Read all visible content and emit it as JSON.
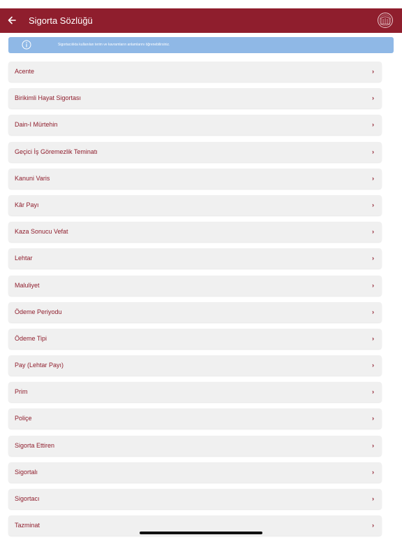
{
  "header": {
    "title": "Sigorta Sözlüğü"
  },
  "info_banner": {
    "text": "Sigortacılıkta kullanılan terim ve kavramların anlamlarını öğrenebilirsiniz."
  },
  "terms": [
    {
      "label": "Acente"
    },
    {
      "label": "Birikimli Hayat Sigortası"
    },
    {
      "label": "Dain-I Mürtehin"
    },
    {
      "label": "Geçici İş Göremezlik Teminatı"
    },
    {
      "label": "Kanuni Varis"
    },
    {
      "label": "Kâr Payı"
    },
    {
      "label": "Kaza Sonucu Vefat"
    },
    {
      "label": "Lehtar"
    },
    {
      "label": "Maluliyet"
    },
    {
      "label": "Ödeme Periyodu"
    },
    {
      "label": "Ödeme Tipi"
    },
    {
      "label": "Pay (Lehtar Payı)"
    },
    {
      "label": "Prim"
    },
    {
      "label": "Poliçe"
    },
    {
      "label": "Sigorta Ettiren"
    },
    {
      "label": "Sigortalı"
    },
    {
      "label": "Sigortacı"
    },
    {
      "label": "Tazminat"
    }
  ],
  "chevron": "›",
  "colors": {
    "brand": "#8f1e2d",
    "banner": "#8fb8e6",
    "row_bg": "#f0f0f0"
  }
}
